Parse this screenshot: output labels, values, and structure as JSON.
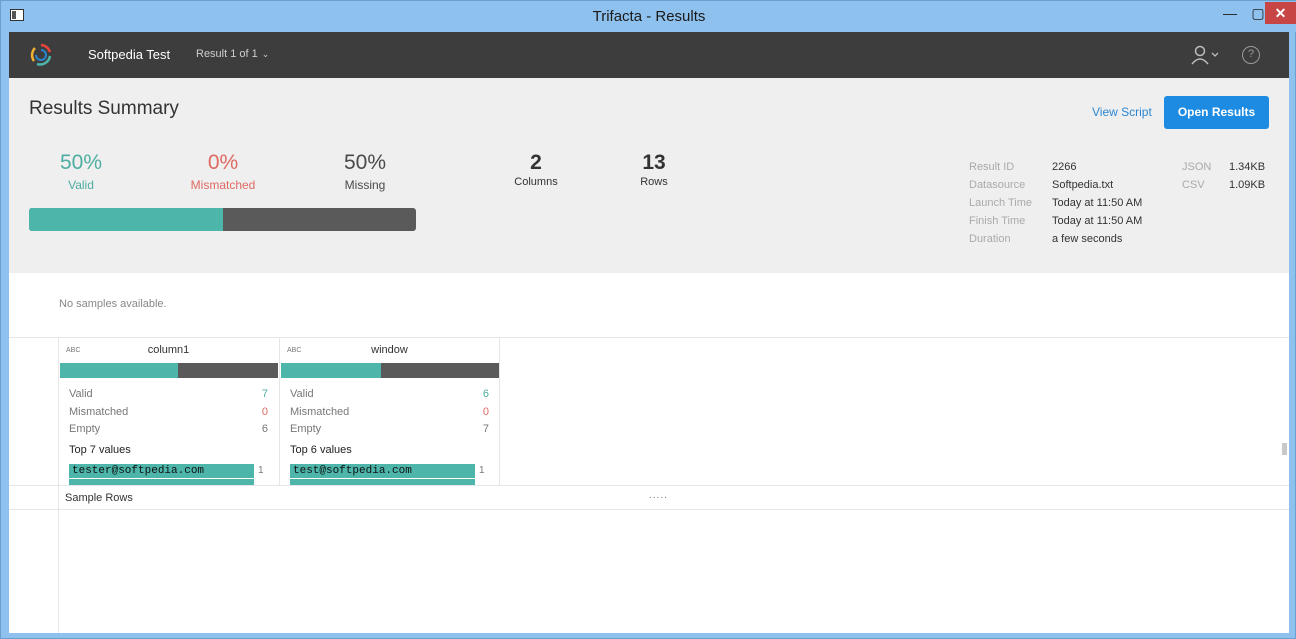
{
  "window": {
    "title": "Trifacta - Results",
    "minimize": "—",
    "maximize": "▢",
    "close": "✕"
  },
  "header": {
    "project": "Softpedia Test",
    "result_selector": "Result 1 of 1",
    "chevron": "⌄",
    "help": "?"
  },
  "summary": {
    "title": "Results Summary",
    "view_script": "View Script",
    "open_results": "Open Results",
    "valid": {
      "value": "50%",
      "label": "Valid"
    },
    "mismatched": {
      "value": "0%",
      "label": "Mismatched"
    },
    "missing": {
      "value": "50%",
      "label": "Missing"
    },
    "columns": {
      "value": "2",
      "label": "Columns"
    },
    "rows": {
      "value": "13",
      "label": "Rows"
    },
    "valid_fraction": 0.5,
    "meta": {
      "result_id_label": "Result ID",
      "result_id": "2266",
      "datasource_label": "Datasource",
      "datasource": "Softpedia.txt",
      "launch_label": "Launch Time",
      "launch": "Today at 11:50 AM",
      "finish_label": "Finish Time",
      "finish": "Today at 11:50 AM",
      "duration_label": "Duration",
      "duration": "a few seconds",
      "json_label": "JSON",
      "json_size": "1.34KB",
      "csv_label": "CSV",
      "csv_size": "1.09KB"
    }
  },
  "samples": {
    "empty": "No samples available."
  },
  "columns": [
    {
      "type": "ABC",
      "name": "column1",
      "valid_fraction": 0.54,
      "valid_label": "Valid",
      "valid": "7",
      "mismatched_label": "Mismatched",
      "mismatched": "0",
      "empty_label": "Empty",
      "empty": "6",
      "top_label": "Top 7 values",
      "top_value": "tester@softpedia.com",
      "top_count": "1"
    },
    {
      "type": "ABC",
      "name": "window",
      "valid_fraction": 0.46,
      "valid_label": "Valid",
      "valid": "6",
      "mismatched_label": "Mismatched",
      "mismatched": "0",
      "empty_label": "Empty",
      "empty": "7",
      "top_label": "Top 6 values",
      "top_value": "test@softpedia.com",
      "top_count": "1"
    }
  ],
  "sample_rows": {
    "title": "Sample Rows",
    "handle": "....."
  },
  "colors": {
    "valid": "#4db5a9",
    "mismatched": "#de6a62",
    "missing": "#5a5a5a",
    "accent": "#1e8be3"
  }
}
